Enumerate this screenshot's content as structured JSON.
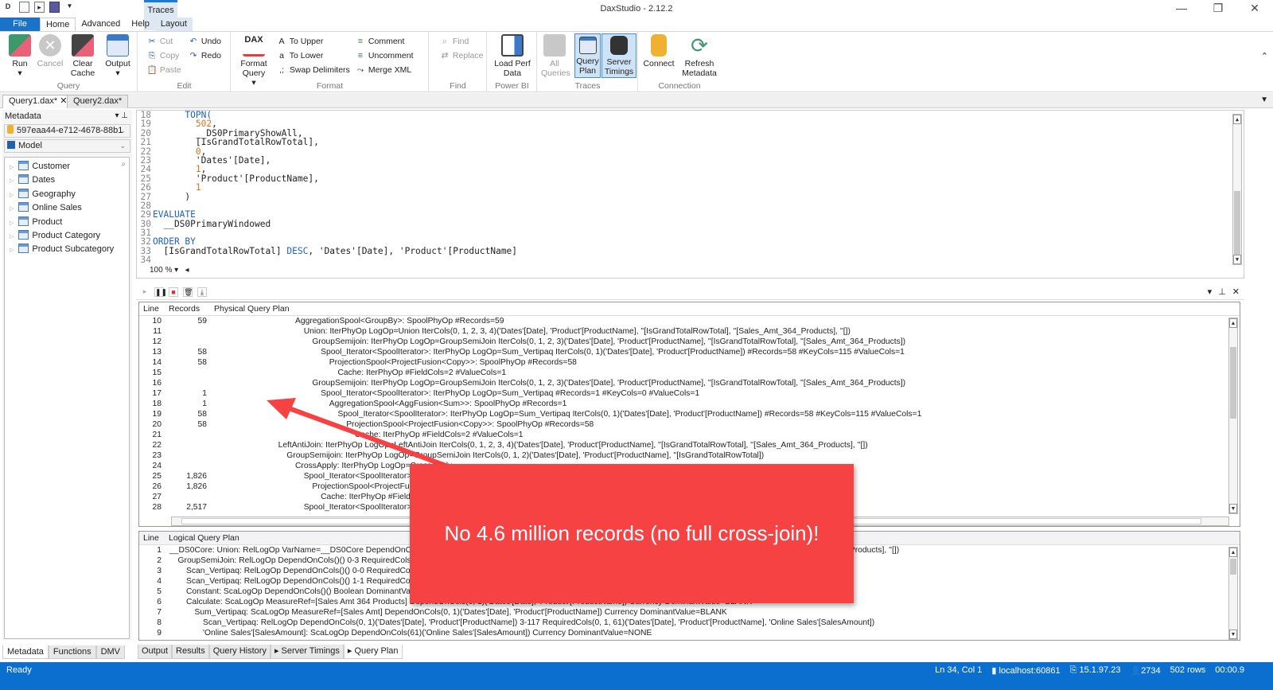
{
  "window": {
    "title": "DaxStudio - 2.12.2",
    "context_tab_group": "Traces",
    "controls": {
      "minimize": "—",
      "restore": "❐",
      "close": "✕"
    }
  },
  "ribbon_tabs": [
    "File",
    "Home",
    "Advanced",
    "Help",
    "Layout"
  ],
  "ribbon": {
    "query": {
      "label": "Query",
      "run": "Run",
      "cancel": "Cancel",
      "clear_cache": "Clear Cache",
      "output": "Output"
    },
    "edit": {
      "label": "Edit",
      "cut": "Cut",
      "copy": "Copy",
      "paste": "Paste",
      "undo": "Undo",
      "redo": "Redo"
    },
    "format": {
      "label": "Format",
      "format_query": "Format Query",
      "to_upper": "To Upper",
      "to_lower": "To Lower",
      "swap_delimiters": "Swap Delimiters",
      "comment": "Comment",
      "uncomment": "Uncomment",
      "merge_xml": "Merge XML"
    },
    "find": {
      "label": "Find",
      "find": "Find",
      "replace": "Replace"
    },
    "powerbi": {
      "label": "Power BI",
      "load_perf": "Load Perf Data"
    },
    "traces": {
      "label": "Traces",
      "all_queries": "All Queries",
      "query_plan": "Query Plan",
      "server_timings": "Server Timings"
    },
    "connection": {
      "label": "Connection",
      "connect": "Connect",
      "refresh": "Refresh Metadata"
    }
  },
  "doc_tabs": [
    {
      "label": "Query1.dax*",
      "active": true
    },
    {
      "label": "Query2.dax*",
      "active": false
    }
  ],
  "metadata": {
    "header": "Metadata",
    "database": "597eaa44-e712-4678-88b1",
    "model": "Model",
    "tables": [
      "Customer",
      "Dates",
      "Geography",
      "Online Sales",
      "Product",
      "Product Category",
      "Product Subcategory"
    ]
  },
  "left_tabs": [
    "Metadata",
    "Functions",
    "DMV"
  ],
  "editor": {
    "zoom": "100 %",
    "lines": [
      {
        "n": "18",
        "html": "      <span class='kw'>TOPN(</span>"
      },
      {
        "n": "19",
        "html": "        <span class='num'>502</span>,"
      },
      {
        "n": "20",
        "html": "        __DS0PrimaryShowAll,"
      },
      {
        "n": "21",
        "html": "        [IsGrandTotalRowTotal],"
      },
      {
        "n": "22",
        "html": "        <span class='num'>0</span>,"
      },
      {
        "n": "23",
        "html": "        'Dates'[Date],"
      },
      {
        "n": "24",
        "html": "        <span class='num'>1</span>,"
      },
      {
        "n": "25",
        "html": "        'Product'[ProductName],"
      },
      {
        "n": "26",
        "html": "        <span class='num'>1</span>"
      },
      {
        "n": "27",
        "html": "      )"
      },
      {
        "n": "28",
        "html": ""
      },
      {
        "n": "29",
        "html": "<span class='kw'>EVALUATE</span>"
      },
      {
        "n": "30",
        "html": "  __DS0PrimaryWindowed"
      },
      {
        "n": "31",
        "html": ""
      },
      {
        "n": "32",
        "html": "<span class='kw'>ORDER BY</span>"
      },
      {
        "n": "33",
        "html": "  [IsGrandTotalRowTotal] <span class='kw'>DESC</span>, 'Dates'[Date], 'Product'[ProductName]"
      },
      {
        "n": "34",
        "html": ""
      }
    ]
  },
  "physical_plan": {
    "headers": [
      "Line",
      "Records",
      "Physical Query Plan"
    ],
    "rows": [
      {
        "line": "10",
        "records": "59",
        "indent": 0,
        "text": "AggregationSpool<GroupBy>: SpoolPhyOp #Records=59"
      },
      {
        "line": "11",
        "records": "",
        "indent": 1,
        "text": "Union: IterPhyOp LogOp=Union IterCols(0, 1, 2, 3, 4)('Dates'[Date], 'Product'[ProductName], ''[IsGrandTotalRowTotal], ''[Sales_Amt_364_Products], ''[])"
      },
      {
        "line": "12",
        "records": "",
        "indent": 2,
        "text": "GroupSemijoin: IterPhyOp LogOp=GroupSemiJoin IterCols(0, 1, 2, 3)('Dates'[Date], 'Product'[ProductName], ''[IsGrandTotalRowTotal], ''[Sales_Amt_364_Products])"
      },
      {
        "line": "13",
        "records": "58",
        "indent": 3,
        "text": "Spool_Iterator<SpoolIterator>: IterPhyOp LogOp=Sum_Vertipaq IterCols(0, 1)('Dates'[Date], 'Product'[ProductName]) #Records=58 #KeyCols=115 #ValueCols=1"
      },
      {
        "line": "14",
        "records": "58",
        "indent": 4,
        "text": "ProjectionSpool<ProjectFusion<Copy>>: SpoolPhyOp #Records=58"
      },
      {
        "line": "15",
        "records": "",
        "indent": 5,
        "text": "Cache: IterPhyOp #FieldCols=2 #ValueCols=1"
      },
      {
        "line": "16",
        "records": "",
        "indent": 2,
        "text": "GroupSemijoin: IterPhyOp LogOp=GroupSemiJoin IterCols(0, 1, 2, 3)('Dates'[Date], 'Product'[ProductName], ''[IsGrandTotalRowTotal], ''[Sales_Amt_364_Products])"
      },
      {
        "line": "17",
        "records": "1",
        "indent": 3,
        "text": "Spool_Iterator<SpoolIterator>: IterPhyOp LogOp=Sum_Vertipaq #Records=1 #KeyCols=0 #ValueCols=1"
      },
      {
        "line": "18",
        "records": "1",
        "indent": 4,
        "text": "AggregationSpool<AggFusion<Sum>>: SpoolPhyOp #Records=1"
      },
      {
        "line": "19",
        "records": "58",
        "indent": 5,
        "text": "Spool_Iterator<SpoolIterator>: IterPhyOp LogOp=Sum_Vertipaq IterCols(0, 1)('Dates'[Date], 'Product'[ProductName]) #Records=58 #KeyCols=115 #ValueCols=1"
      },
      {
        "line": "20",
        "records": "58",
        "indent": 6,
        "text": "ProjectionSpool<ProjectFusion<Copy>>: SpoolPhyOp #Records=58"
      },
      {
        "line": "21",
        "records": "",
        "indent": 7,
        "text": "Cache: IterPhyOp #FieldCols=2 #ValueCols=1"
      },
      {
        "line": "22",
        "records": "",
        "indent": -2,
        "text": "LeftAntiJoin: IterPhyOp LogOp=LeftAntiJoin IterCols(0, 1, 2, 3, 4)('Dates'[Date], 'Product'[ProductName], ''[IsGrandTotalRowTotal], ''[Sales_Amt_364_Products], ''[])"
      },
      {
        "line": "23",
        "records": "",
        "indent": -1,
        "text": "GroupSemijoin: IterPhyOp LogOp=GroupSemiJoin IterCols(0, 1, 2)('Dates'[Date], 'Product'[ProductName], ''[IsGrandTotalRowTotal])"
      },
      {
        "line": "24",
        "records": "",
        "indent": 0,
        "text": "CrossApply: IterPhyOp LogOp=CrossApply"
      },
      {
        "line": "25",
        "records": "1,826",
        "indent": 1,
        "text": "Spool_Iterator<SpoolIterator>"
      },
      {
        "line": "26",
        "records": "1,826",
        "indent": 2,
        "text": "ProjectionSpool<ProjectFusion"
      },
      {
        "line": "27",
        "records": "",
        "indent": 3,
        "text": "Cache: IterPhyOp #FieldCols"
      },
      {
        "line": "28",
        "records": "2,517",
        "indent": 1,
        "text": "Spool_Iterator<SpoolIterator>"
      }
    ]
  },
  "logical_plan": {
    "headers": [
      "Line",
      "Logical Query Plan"
    ],
    "rows": [
      {
        "line": "1",
        "indent": 0,
        "text": "__DS0Core: Union: RelLogOp VarName=__DS0Core DependOnCols()() 0-4 RequiredCols(0, 1, 2, 3, 4)('Dates'[Date], 'Product'[ProductName], ''[IsGrandTotalRowTotal], ''[Sales_Amt_364_Products], ''[])"
      },
      {
        "line": "2",
        "indent": 1,
        "text": "GroupSemiJoin: RelLogOp DependOnCols()() 0-3 RequiredCols(0, 1, 2, 3)"
      },
      {
        "line": "3",
        "indent": 2,
        "text": "Scan_Vertipaq: RelLogOp DependOnCols()() 0-0 RequiredCols(0)"
      },
      {
        "line": "4",
        "indent": 2,
        "text": "Scan_Vertipaq: RelLogOp DependOnCols()() 1-1 RequiredCols(1)"
      },
      {
        "line": "5",
        "indent": 2,
        "text": "Constant: ScaLogOp DependOnCols()() Boolean DominantValue=false"
      },
      {
        "line": "6",
        "indent": 2,
        "text": "Calculate: ScaLogOp MeasureRef=[Sales Amt 364 Products] DependOnCols(0, 1)('Dates'[Date], 'Product'[ProductName]) Currency DominantValue=BLANK"
      },
      {
        "line": "7",
        "indent": 3,
        "text": "Sum_Vertipaq: ScaLogOp MeasureRef=[Sales Amt] DependOnCols(0, 1)('Dates'[Date], 'Product'[ProductName]) Currency DominantValue=BLANK"
      },
      {
        "line": "8",
        "indent": 4,
        "text": "Scan_Vertipaq: RelLogOp DependOnCols(0, 1)('Dates'[Date], 'Product'[ProductName]) 3-117 RequiredCols(0, 1, 61)('Dates'[Date], 'Product'[ProductName], 'Online Sales'[SalesAmount])"
      },
      {
        "line": "9",
        "indent": 4,
        "text": "'Online Sales'[SalesAmount]: ScaLogOp DependOnCols(61)('Online Sales'[SalesAmount]) Currency DominantValue=NONE"
      }
    ]
  },
  "bottom_tabs": [
    {
      "label": "Output",
      "arrow": false
    },
    {
      "label": "Results",
      "arrow": false
    },
    {
      "label": "Query History",
      "arrow": false
    },
    {
      "label": "Server Timings",
      "arrow": true
    },
    {
      "label": "Query Plan",
      "arrow": true,
      "active": true
    }
  ],
  "status": {
    "ready": "Ready",
    "position": "Ln 34, Col 1",
    "server": "localhost:60861",
    "version": "15.1.97.23",
    "spid": "2734",
    "rows": "502 rows",
    "duration": "00:00.9"
  },
  "annotation": {
    "text": "No 4.6 million records (no full cross-join)!",
    "color": "#f74244"
  }
}
